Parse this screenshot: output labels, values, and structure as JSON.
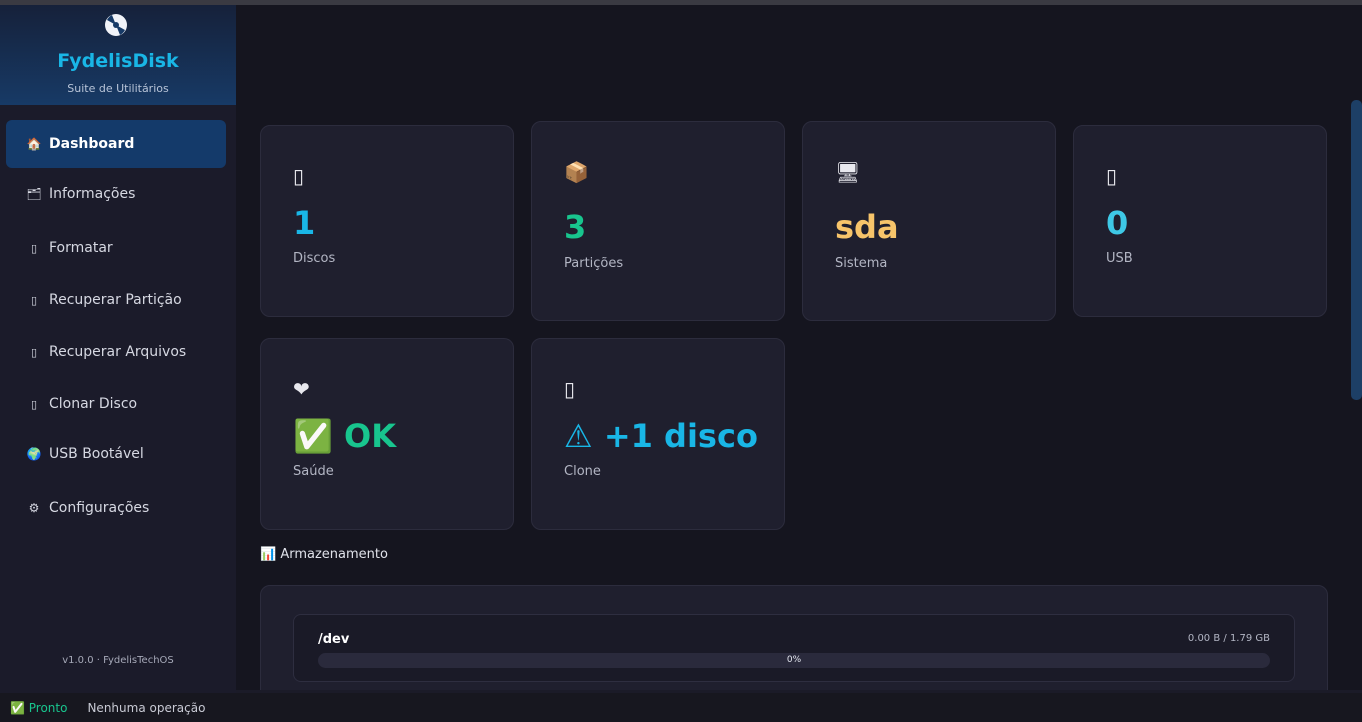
{
  "app": {
    "title": "FydelisDisk",
    "subtitle": "Suite de Utilitários",
    "version": "v1.0.0 · FydelisTechOS"
  },
  "sidebar": {
    "items": [
      {
        "icon": "🏠",
        "label": "Dashboard",
        "active": true
      },
      {
        "icon": "🗂",
        "label": "Informações"
      },
      {
        "icon": "▯",
        "label": "Formatar"
      },
      {
        "icon": "▯",
        "label": "Recuperar Partição"
      },
      {
        "icon": "▯",
        "label": "Recuperar Arquivos"
      },
      {
        "icon": "▯",
        "label": "Clonar Disco"
      },
      {
        "icon": "🌍",
        "label": "USB Bootável"
      },
      {
        "icon": "⚙",
        "label": "Configurações"
      }
    ]
  },
  "cards": [
    {
      "icon": "▯",
      "value": "1",
      "label": "Discos",
      "color": "#19b6e6"
    },
    {
      "icon": "📦",
      "value": "3",
      "label": "Partições",
      "color": "#18c58e"
    },
    {
      "icon": "🖥",
      "value": "sda",
      "label": "Sistema",
      "color": "#f7c46a"
    },
    {
      "icon": "▯",
      "value": "0",
      "label": "USB",
      "color": "#3ec8e6"
    },
    {
      "icon": "❤",
      "value": "✅ OK",
      "label": "Saúde",
      "color": "#18c58e"
    },
    {
      "icon": "▯",
      "value": "⚠ +1 disco",
      "label": "Clone",
      "color": "#19b6e6"
    }
  ],
  "storage": {
    "section_title": "📊 Armazenamento",
    "items": [
      {
        "name": "/dev",
        "size": "0.00 B / 1.79 GB",
        "percent_text": "0%",
        "percent": 0
      }
    ]
  },
  "status": {
    "state": "✅ Pronto",
    "operation": "Nenhuma operação"
  },
  "colors": {
    "accent": "#19b6e6",
    "success": "#18c58e",
    "warning": "#f7c46a",
    "background": "#15151f",
    "card": "#1f1f2e"
  }
}
